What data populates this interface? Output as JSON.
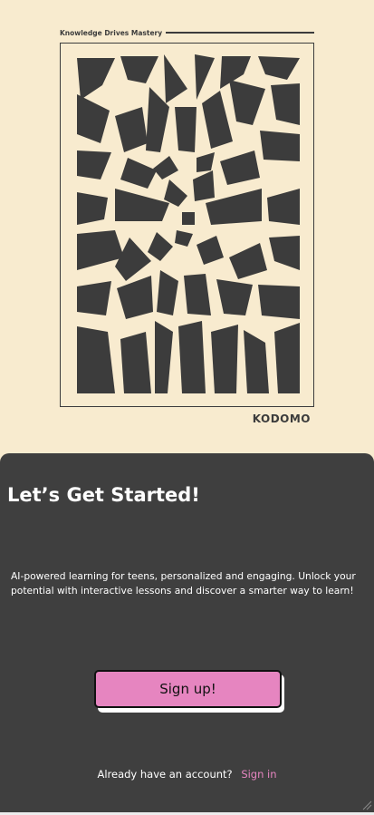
{
  "poster": {
    "tagline": "Knowledge Drives Mastery",
    "brand": "KODOMO",
    "artwork_icon": "abstract-op-art-pattern"
  },
  "welcome": {
    "title": "Let’s Get Started!",
    "description": "AI-powered learning for teens, personalized and engaging. Unlock your potential with interactive lessons and discover a smarter way to learn!",
    "signup_label": "Sign up!",
    "account_prompt": "Already have an account?",
    "signin_label": "Sign in"
  },
  "colors": {
    "background": "#F8EBCF",
    "card": "#3F3F3F",
    "accent_pink": "#E685C0",
    "ink": "#3C3C3C"
  }
}
